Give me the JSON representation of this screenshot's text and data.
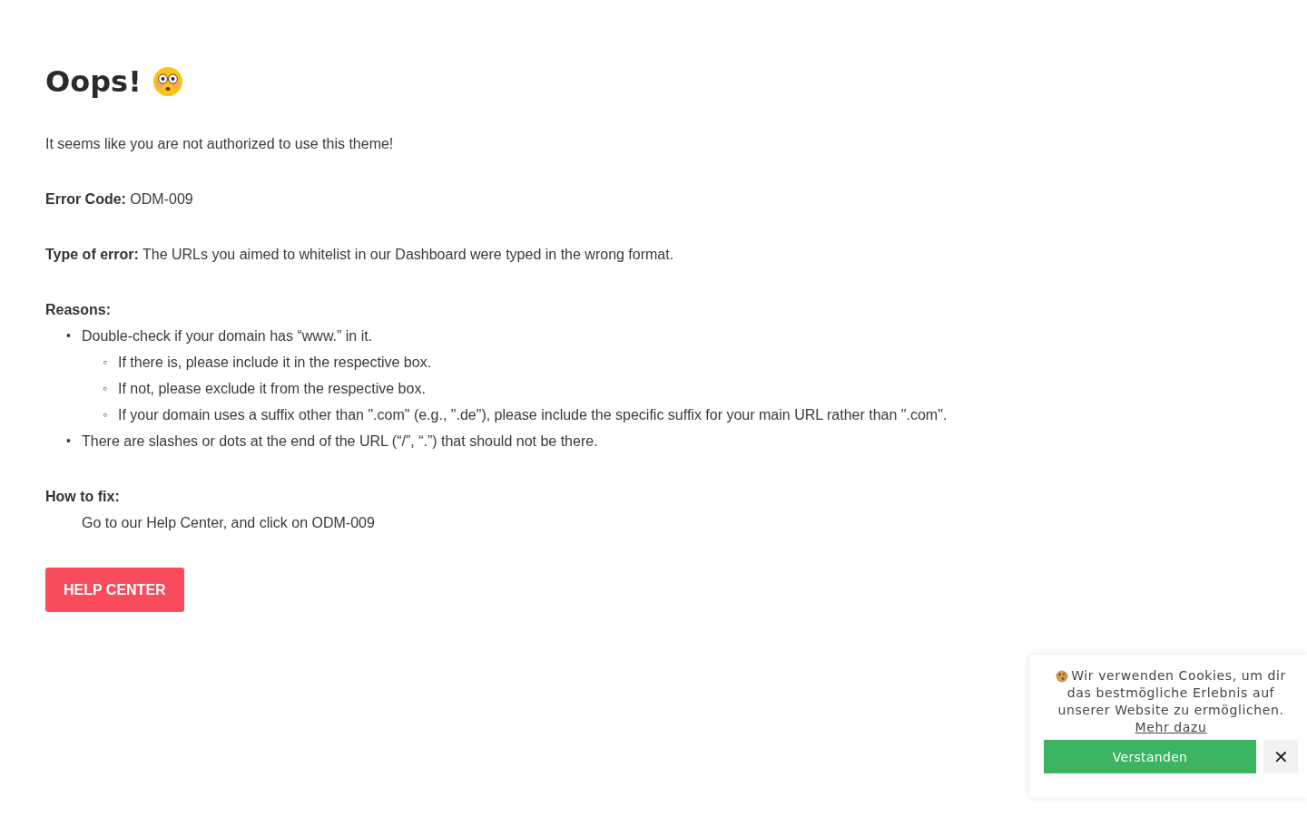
{
  "heading": {
    "text": "Oops!"
  },
  "intro": "It seems like you are not authorized to use this theme!",
  "details": [
    "**Error Code:** ODM-009",
    "**Type of error:** The URLs you aimed to whitelist in our Dashboard were typed in the wrong format."
  ],
  "reasons": {
    "label": "Reasons:",
    "items": [
      {
        "marker": "•",
        "text": "Double-check if your domain has “www.” in it.",
        "children": [
          {
            "marker": "◦",
            "text": "If there is, please include it in the respective box."
          },
          {
            "marker": "◦",
            "text": "If not, please exclude it from the respective box."
          },
          {
            "marker": "◦",
            "text": "If your domain uses a suffix other than \".com\" (e.g., \".de\"), please include the specific suffix for your main URL rather than \".com\"."
          }
        ]
      },
      {
        "marker": "•",
        "text": "There are slashes or dots at the end of the URL (“/”, “.”) that should not be there."
      }
    ]
  },
  "fix": {
    "label": "How to fix:",
    "text": "Go to our Help Center, and click on ODM-009"
  },
  "button": "HELP CENTER",
  "cookie_banner": {
    "text_lines": [
      "Wir verwenden Cookies, um dir",
      "das bestmögliche Erlebnis auf",
      "unserer Website zu ermöglichen."
    ],
    "link": "Mehr dazu",
    "accept": "Verstanden",
    "close": "✕"
  }
}
